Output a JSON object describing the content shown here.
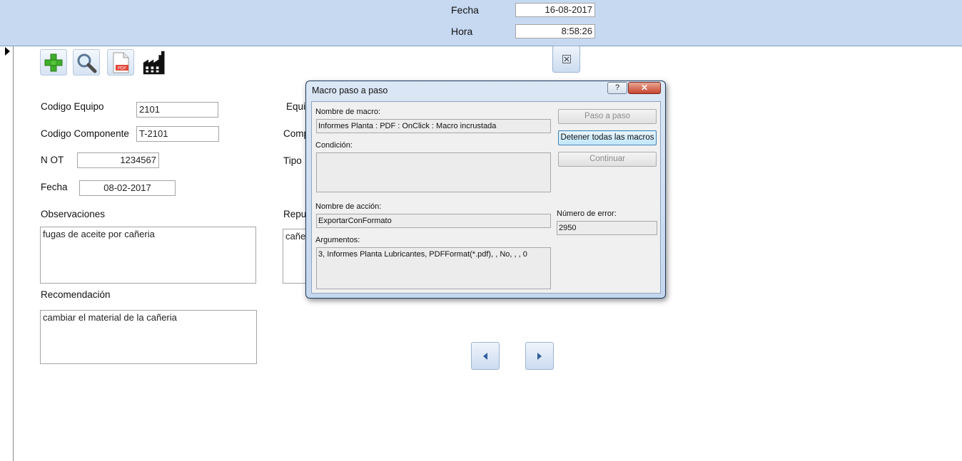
{
  "header": {
    "fecha_label": "Fecha",
    "fecha_value": "16-08-2017",
    "hora_label": "Hora",
    "hora_value": "8:58:26"
  },
  "toolbar": {
    "buttons": [
      {
        "name": "add-record-button",
        "icon": "plus-icon"
      },
      {
        "name": "search-button",
        "icon": "search-icon"
      },
      {
        "name": "pdf-button",
        "icon": "pdf-icon",
        "icon_text": "PDF"
      },
      {
        "name": "plant-button",
        "icon": "factory-icon"
      }
    ]
  },
  "form": {
    "codigo_equipo_label": "Codigo Equipo",
    "codigo_equipo_value": "2101",
    "codigo_componente_label": "Codigo Componente",
    "codigo_componente_value": "T-2101",
    "not_label": "N OT",
    "not_value": "1234567",
    "fecha_label": "Fecha",
    "fecha_value": "08-02-2017",
    "observaciones_label": "Observaciones",
    "observaciones_value": "fugas de aceite por cañeria",
    "recomendacion_label": "Recomendación",
    "recomendacion_value": "cambiar el material de la cañeria",
    "equipo_label_partial": "Equi",
    "componente_label_partial": "Comp",
    "tipo_label_partial": "Tipo",
    "repuesto_label_partial": "Repu",
    "repuesto_value_partial": "cañe"
  },
  "dialog": {
    "title": "Macro paso a paso",
    "help_label": "?",
    "close_label": "✕",
    "macro_name_label": "Nombre de macro:",
    "macro_name_value": "Informes Planta : PDF : OnClick : Macro incrustada",
    "condition_label": "Condición:",
    "condition_value": "",
    "action_name_label": "Nombre de acción:",
    "action_name_value": "ExportarConFormato",
    "arguments_label": "Argumentos:",
    "arguments_value": "3, Informes Planta Lubricantes, PDFFormat(*.pdf), , No, , , 0",
    "error_number_label": "Número de error:",
    "error_number_value": "2950",
    "buttons": {
      "step": "Paso a paso",
      "stop_all": "Detener todas las macros",
      "continue": "Continuar"
    }
  },
  "nav": {
    "close_icon": "close-icon",
    "prev_icon": "triangle-left-icon",
    "next_icon": "triangle-right-icon"
  },
  "colors": {
    "header_bg": "#c6d9f1",
    "dialog_bg": "#c5d7ee",
    "close_red": "#c8442e"
  }
}
